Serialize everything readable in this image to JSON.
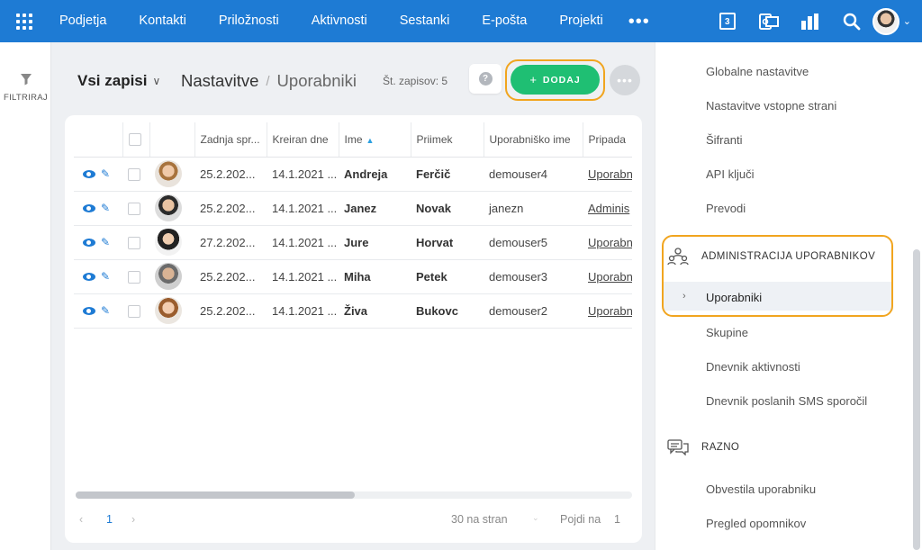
{
  "topbar": {
    "nav": [
      "Podjetja",
      "Kontakti",
      "Priložnosti",
      "Aktivnosti",
      "Sestanki",
      "E-pošta",
      "Projekti"
    ],
    "more": "•••",
    "calendar_day": "3"
  },
  "left": {
    "filter_label": "FILTRIRAJ"
  },
  "header": {
    "view": "Vsi zapisi",
    "crumb_parent": "Nastavitve",
    "crumb_sep": "/",
    "crumb_current": "Uporabniki",
    "count": "Št. zapisov: 5",
    "add_label": "DODAJ",
    "help": "?",
    "more": "•••"
  },
  "table": {
    "columns": [
      "Zadnja spr...",
      "Kreiran dne",
      "Ime",
      "Priimek",
      "Uporabniško ime",
      "Pripada"
    ],
    "rows": [
      {
        "modified": "25.2.202...",
        "created": "14.1.2021 ...",
        "first": "Andreja",
        "last": "Ferčič",
        "username": "demouser4",
        "group": "Uporabni"
      },
      {
        "modified": "25.2.202...",
        "created": "14.1.2021 ...",
        "first": "Janez",
        "last": "Novak",
        "username": "janezn",
        "group": "Adminis"
      },
      {
        "modified": "27.2.202...",
        "created": "14.1.2021 ...",
        "first": "Jure",
        "last": "Horvat",
        "username": "demouser5",
        "group": "Uporabni"
      },
      {
        "modified": "25.2.202...",
        "created": "14.1.2021 ...",
        "first": "Miha",
        "last": "Petek",
        "username": "demouser3",
        "group": "Uporabni"
      },
      {
        "modified": "25.2.202...",
        "created": "14.1.2021 ...",
        "first": "Živa",
        "last": "Bukovc",
        "username": "demouser2",
        "group": "Uporabni"
      }
    ]
  },
  "pager": {
    "prev": "‹",
    "page": "1",
    "next": "›",
    "page_size": "30 na stran",
    "goto_label": "Pojdi na",
    "goto_value": "1"
  },
  "rpanel": {
    "items_top": [
      "Globalne nastavitve",
      "Nastavitve vstopne strani",
      "Šifranti",
      "API ključi",
      "Prevodi"
    ],
    "section_admin": "ADMINISTRACIJA UPORABNIKOV",
    "active_item": "Uporabniki",
    "items_admin": [
      "Skupine",
      "Dnevnik aktivnosti",
      "Dnevnik poslanih SMS sporočil"
    ],
    "section_misc": "RAZNO",
    "items_misc": [
      "Obvestila uporabniku",
      "Pregled opomnikov"
    ]
  },
  "colors": {
    "primary": "#1e7bd4",
    "add_button": "#1fbf73",
    "highlight": "#f1a51f"
  }
}
